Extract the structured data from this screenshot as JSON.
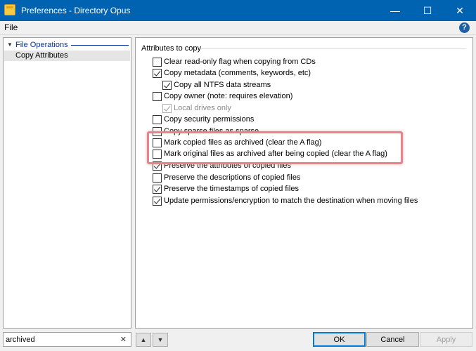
{
  "window": {
    "title": "Preferences - Directory Opus",
    "minimize_icon": "—",
    "maximize_icon": "☐",
    "close_icon": "✕"
  },
  "menu": {
    "file": "File",
    "help_icon": "?"
  },
  "tree": {
    "group_label": "File Operations",
    "selected_item": "Copy Attributes"
  },
  "content": {
    "section_title": "Attributes to copy",
    "options": [
      {
        "label": "Clear read-only flag when copying from CDs",
        "checked": false,
        "disabled": false
      },
      {
        "label": "Copy metadata (comments, keywords, etc)",
        "checked": true,
        "disabled": false
      },
      {
        "label": "Copy all NTFS data streams",
        "checked": true,
        "disabled": false
      },
      {
        "label": "Copy owner (note: requires elevation)",
        "checked": false,
        "disabled": false
      },
      {
        "label": "Local drives only",
        "checked": true,
        "disabled": true
      },
      {
        "label": "Copy security permissions",
        "checked": false,
        "disabled": false
      },
      {
        "label": "Copy sparse files as sparse",
        "checked": false,
        "disabled": false
      },
      {
        "label": "Mark copied files as archived (clear the A flag)",
        "checked": false,
        "disabled": false
      },
      {
        "label": "Mark original files as archived after being copied (clear the A flag)",
        "checked": false,
        "disabled": false
      },
      {
        "label": "Preserve the attributes of copied files",
        "checked": true,
        "disabled": false
      },
      {
        "label": "Preserve the descriptions of copied files",
        "checked": false,
        "disabled": false
      },
      {
        "label": "Preserve the timestamps of copied files",
        "checked": true,
        "disabled": false
      },
      {
        "label": "Update permissions/encryption to match the destination when moving files",
        "checked": true,
        "disabled": false
      }
    ]
  },
  "search": {
    "value": "archived",
    "clear_icon": "✕"
  },
  "nav": {
    "up_icon": "▲",
    "down_icon": "▼"
  },
  "buttons": {
    "ok": "OK",
    "cancel": "Cancel",
    "apply": "Apply"
  },
  "colors": {
    "titlebar": "#0063b1",
    "highlight": "#e8838b",
    "tree_group": "#003399"
  }
}
